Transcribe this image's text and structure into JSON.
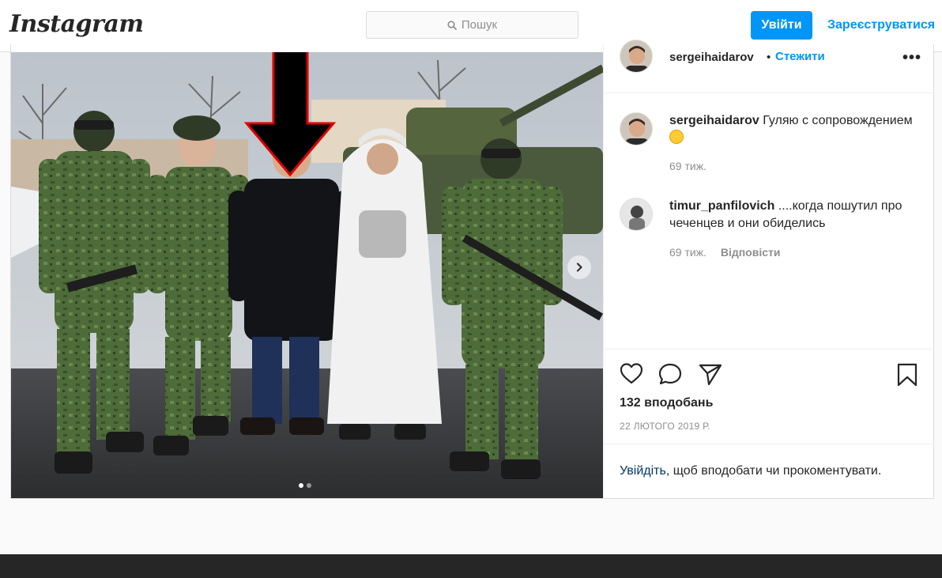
{
  "header": {
    "logo": "Instagram",
    "search_placeholder": "Пошук",
    "login_label": "Увійти",
    "signup_label": "Зареєструватися"
  },
  "post": {
    "author": "sergeihaidarov",
    "separator": "•",
    "follow_label": "Стежити",
    "more_label": "•••",
    "caption": {
      "user": "sergeihaidarov",
      "text": "Гуляю с сопровождением"
    },
    "caption_meta": "69 тиж.",
    "comments": [
      {
        "user": "timur_panfilovich",
        "text": "....когда пошутил про чеченцев и они обиделись",
        "age": "69 тиж.",
        "reply_label": "Відповісти"
      }
    ],
    "likes": "132 вподобань",
    "date": "22 ЛЮТОГО 2019 Р.",
    "login_prompt": {
      "link": "Увійдіть",
      "rest": ", щоб вподобати чи прокоментувати."
    },
    "carousel": {
      "current": 1,
      "total": 2
    }
  },
  "icons": {
    "search": "search-icon",
    "like": "heart-icon",
    "comment": "comment-icon",
    "share": "paper-plane-icon",
    "save": "bookmark-icon",
    "next": "chevron-right-icon",
    "annotation": "down-arrow-icon"
  },
  "colors": {
    "accent": "#0095f6",
    "link_dark": "#00376b",
    "text": "#262626",
    "muted": "#8e8e8e",
    "annotation_outline": "#e00000"
  }
}
